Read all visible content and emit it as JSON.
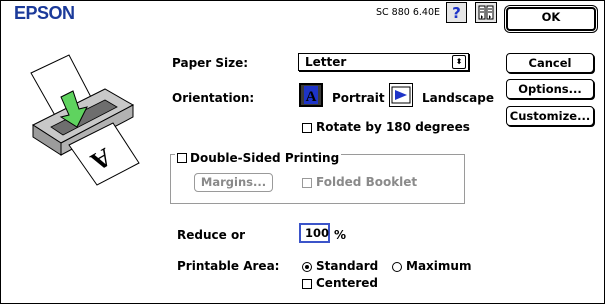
{
  "header": {
    "brand": "EPSON",
    "version": "SC 880 6.40E",
    "help_symbol": "?"
  },
  "buttons": {
    "ok": "OK",
    "cancel": "Cancel",
    "options": "Options...",
    "customize": "Customize..."
  },
  "paper_size": {
    "label": "Paper Size:",
    "value": "Letter",
    "arrow_symbol": "⬍"
  },
  "orientation": {
    "label": "Orientation:",
    "portrait": "Portrait",
    "landscape": "Landscape",
    "selected": "portrait",
    "rotate_label": "Rotate by 180 degrees",
    "rotate_checked": false
  },
  "double_sided": {
    "label": "Double-Sided Printing",
    "checked": false,
    "margins_button": "Margins...",
    "folded_booklet": "Folded Booklet",
    "folded_checked": false
  },
  "reduce": {
    "label": "Reduce or",
    "value": "100",
    "unit": "%"
  },
  "printable_area": {
    "label": "Printable Area:",
    "options": [
      "Standard",
      "Maximum"
    ],
    "selected": "Standard",
    "centered_label": "Centered",
    "centered_checked": false
  },
  "colors": {
    "brand_blue": "#1b3a9a",
    "focus_blue": "#3b54c9",
    "disabled_grey": "#8a8a8a",
    "arrow_green": "#5fd35f"
  }
}
